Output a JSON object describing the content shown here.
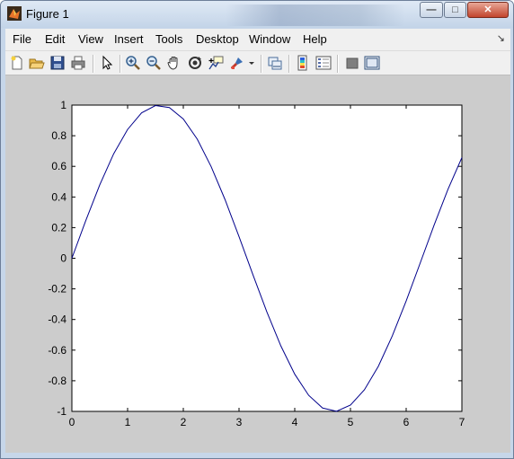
{
  "window": {
    "title": "Figure 1",
    "minimize_glyph": "—",
    "maximize_glyph": "□",
    "close_glyph": "✕"
  },
  "menu": {
    "items": [
      "File",
      "Edit",
      "View",
      "Insert",
      "Tools",
      "Desktop",
      "Window",
      "Help"
    ],
    "overflow_glyph": "↘"
  },
  "toolbar": {
    "buttons": [
      "new-figure",
      "open-file",
      "save",
      "print",
      "edit-plot",
      "zoom-in",
      "zoom-out",
      "pan",
      "rotate-3d",
      "data-cursor",
      "brush",
      "brush-dropdown",
      "link-plot",
      "insert-colorbar",
      "insert-legend",
      "hide-plot-tools",
      "show-plot-tools"
    ]
  },
  "colors": {
    "line": "#00008b",
    "axes_bg": "#ffffff",
    "figure_bg": "#cccccc",
    "accent_close": "#c2452d"
  },
  "chart_data": {
    "type": "line",
    "title": "",
    "xlabel": "",
    "ylabel": "",
    "xlim": [
      0,
      7
    ],
    "ylim": [
      -1,
      1
    ],
    "xticks": [
      0,
      1,
      2,
      3,
      4,
      5,
      6,
      7
    ],
    "yticks": [
      1,
      0.8,
      0.6,
      0.4,
      0.2,
      0,
      -0.2,
      -0.4,
      -0.6,
      -0.8,
      -1
    ],
    "xtick_labels": [
      "0",
      "1",
      "2",
      "3",
      "4",
      "5",
      "6",
      "7"
    ],
    "ytick_labels": [
      "1",
      "0.8",
      "0.6",
      "0.4",
      "0.2",
      "0",
      "-0.2",
      "-0.4",
      "-0.6",
      "-0.8",
      "-1"
    ],
    "grid": false,
    "series": [
      {
        "x": [
          0,
          0.25,
          0.5,
          0.75,
          1,
          1.25,
          1.5,
          1.75,
          2,
          2.25,
          2.5,
          2.75,
          3,
          3.25,
          3.5,
          3.75,
          4,
          4.25,
          4.5,
          4.75,
          5,
          5.25,
          5.5,
          5.75,
          6,
          6.25,
          6.5,
          6.75,
          7
        ],
        "y": [
          0,
          0.247,
          0.479,
          0.682,
          0.841,
          0.949,
          0.997,
          0.984,
          0.909,
          0.778,
          0.598,
          0.382,
          0.141,
          -0.108,
          -0.351,
          -0.572,
          -0.757,
          -0.895,
          -0.978,
          -0.999,
          -0.959,
          -0.859,
          -0.706,
          -0.508,
          -0.279,
          -0.033,
          0.215,
          0.45,
          0.657
        ]
      }
    ]
  }
}
